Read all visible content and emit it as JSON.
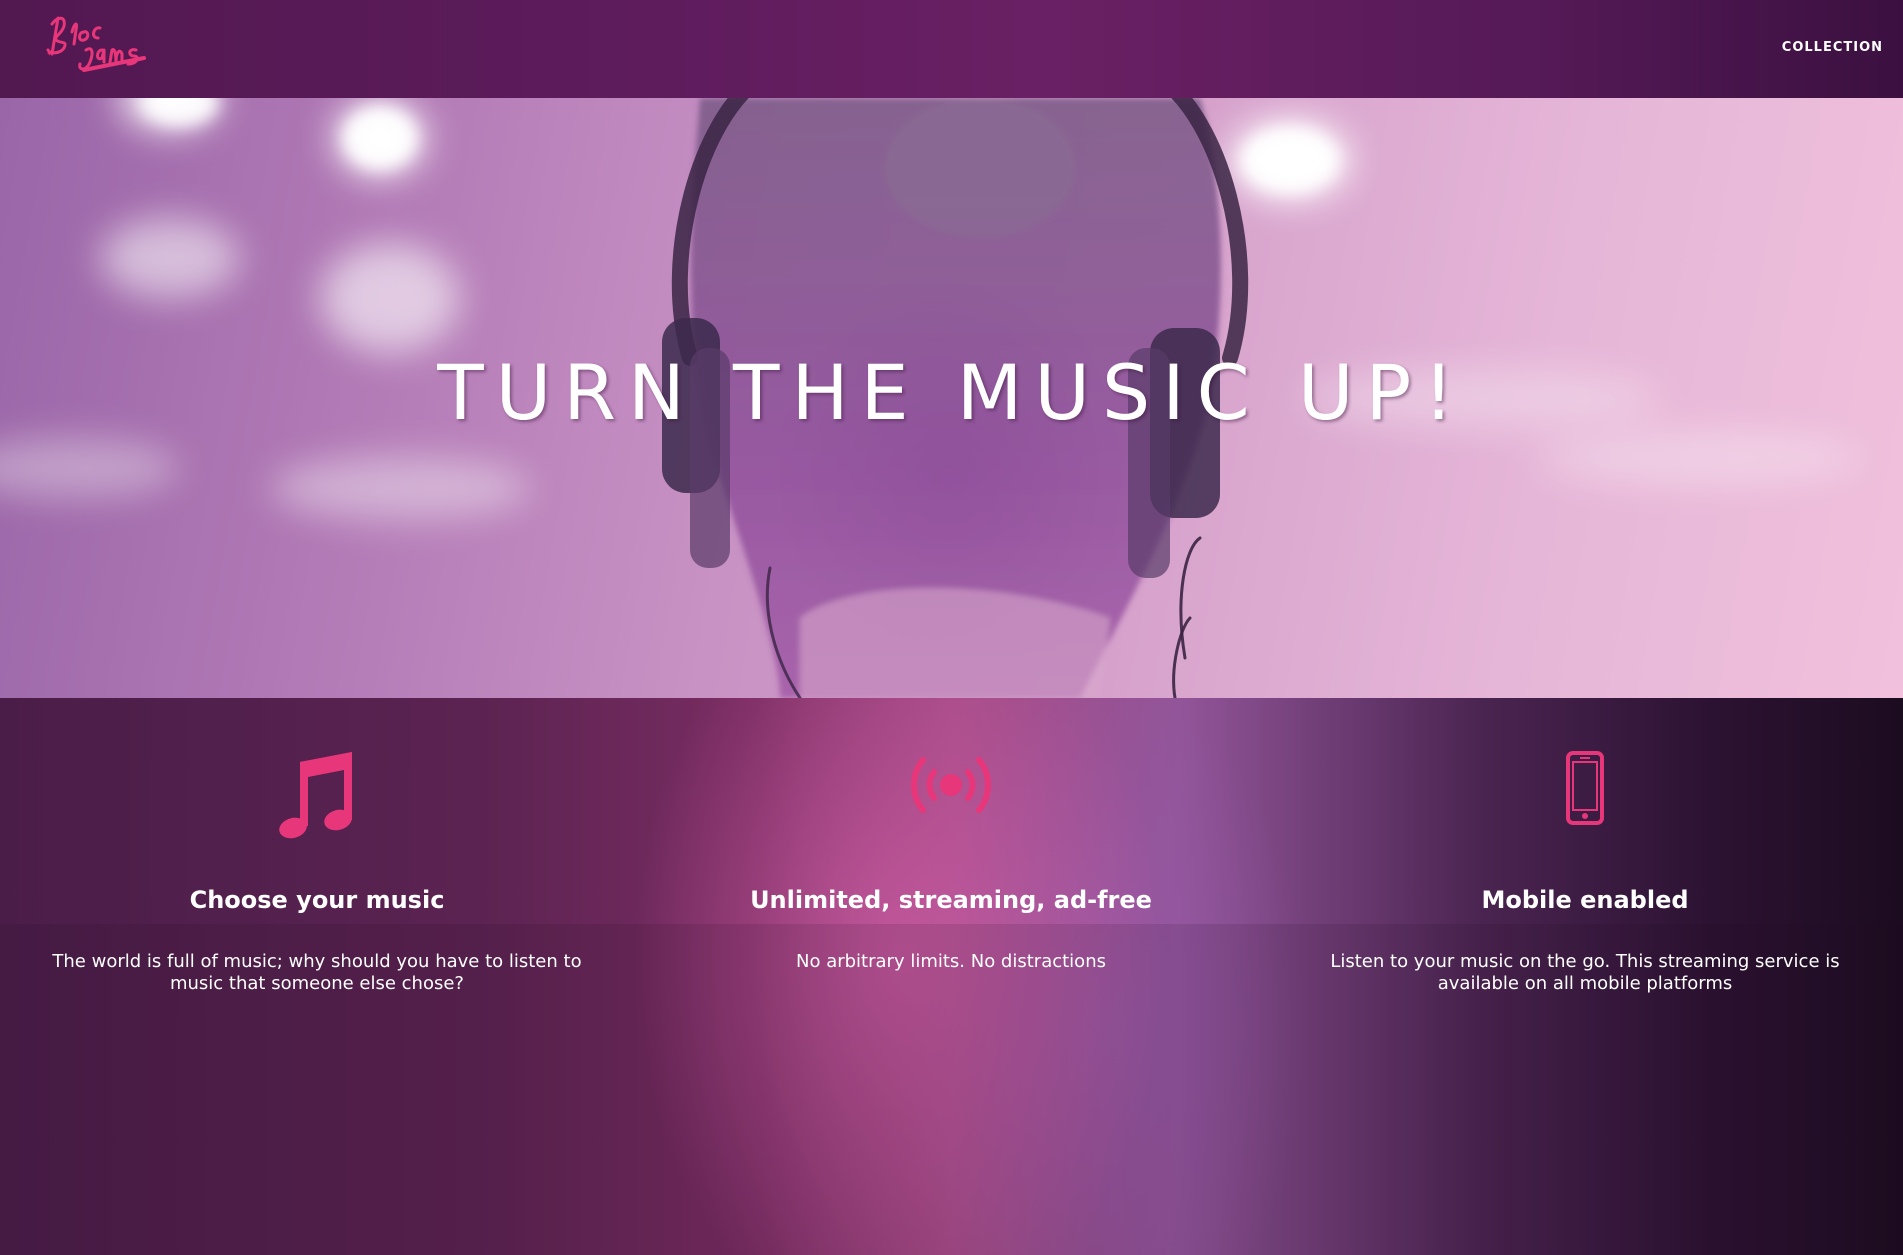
{
  "navbar": {
    "logo_text": "Bloc Jams",
    "links": [
      {
        "label": "COLLECTION"
      }
    ]
  },
  "hero": {
    "title": "TURN THE MUSIC UP!"
  },
  "selling_points": [
    {
      "icon": "music-note-icon",
      "title": "Choose your music",
      "description": "The world is full of music; why should you have to listen to music that someone else chose?"
    },
    {
      "icon": "radio-waves-icon",
      "title": "Unlimited, streaming, ad-free",
      "description": "No arbitrary limits. No distractions"
    },
    {
      "icon": "mobile-phone-icon",
      "title": "Mobile enabled",
      "description": "Listen to your music on the go. This streaming service is available on all mobile platforms"
    }
  ],
  "colors": {
    "accent": "#e8367a",
    "navbar": "#5e1c5d",
    "text": "#ffffff"
  }
}
